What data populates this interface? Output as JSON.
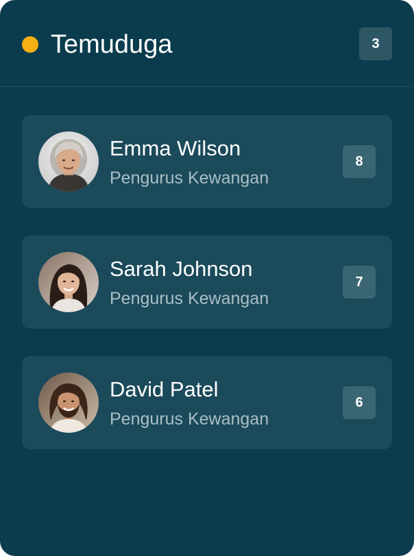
{
  "header": {
    "title": "Temuduga",
    "count": "3",
    "dot_color": "#f5b014"
  },
  "candidates": [
    {
      "name": "Emma Wilson",
      "role": "Pengurus Kewangan",
      "score": "8",
      "avatar_icon": "avatar-older-woman"
    },
    {
      "name": "Sarah Johnson",
      "role": "Pengurus Kewangan",
      "score": "7",
      "avatar_icon": "avatar-young-woman"
    },
    {
      "name": "David Patel",
      "role": "Pengurus Kewangan",
      "score": "6",
      "avatar_icon": "avatar-bearded-man"
    }
  ],
  "colors": {
    "panel_bg": "#0b3c4d",
    "card_bg": "#1b4a5a",
    "badge_bg": "#3a6572",
    "accent": "#f5b014"
  }
}
